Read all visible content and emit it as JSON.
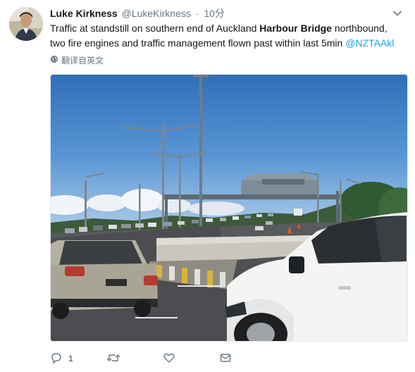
{
  "author": {
    "display_name": "Luke Kirkness",
    "handle": "@LukeKirkness",
    "separator": "·",
    "time": "10分"
  },
  "tweet": {
    "text_part1": "Traffic at standstill on southern end of Auckland ",
    "text_bold": "Harbour Bridge",
    "text_part2": " northbound,",
    "text_line2": "two fire engines and traffic management flown past within last 5min ",
    "mention": "@NZTAAkl"
  },
  "translate": {
    "label": "翻译自英文",
    "icon": "globe-icon"
  },
  "media": {
    "alt_icon": "traffic-photo"
  },
  "actions": {
    "reply_count": "1",
    "reply_icon": "reply-icon",
    "retweet_icon": "retweet-icon",
    "like_icon": "heart-icon",
    "dm_icon": "envelope-icon"
  },
  "colors": {
    "link": "#1da1f2",
    "secondary": "#657786",
    "text": "#14171a"
  }
}
